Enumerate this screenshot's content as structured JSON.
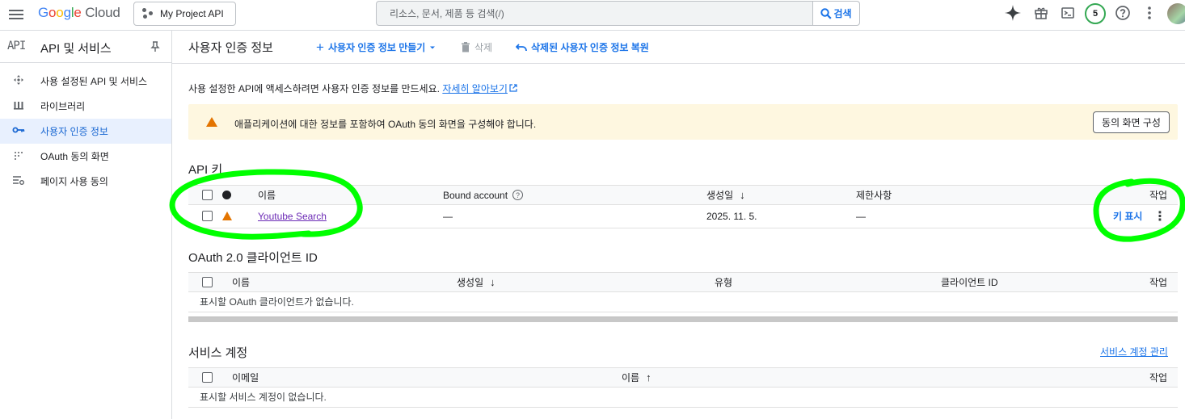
{
  "topbar": {
    "logo_parts": [
      "G",
      "o",
      "o",
      "g",
      "l",
      "e"
    ],
    "logo_cloud": "Cloud",
    "project_name": "My Project API",
    "search_placeholder": "리소스, 문서, 제품 등 검색(/)",
    "search_button": "검색",
    "notification_count": "5",
    "icons": [
      "menu-icon",
      "project-icon",
      "search-icon",
      "gemini-icon",
      "gift-icon",
      "terminal-icon",
      "help-icon",
      "more-vert-icon"
    ]
  },
  "sidebar": {
    "api_mark": "API",
    "title": "API 및 서비스",
    "items": [
      {
        "label": "사용 설정된 API 및 서비스",
        "icon": "enabled-apis-icon"
      },
      {
        "label": "라이브러리",
        "icon": "library-icon"
      },
      {
        "label": "사용자 인증 정보",
        "icon": "key-icon",
        "active": true
      },
      {
        "label": "OAuth 동의 화면",
        "icon": "oauth-icon"
      },
      {
        "label": "페이지 사용 동의",
        "icon": "page-consent-icon"
      }
    ]
  },
  "header": {
    "title": "사용자 인증 정보",
    "create_label": "사용자 인증 정보 만들기",
    "delete_label": "삭제",
    "restore_label": "삭제된 사용자 인증 정보 복원"
  },
  "intro": {
    "text": "사용 설정한 API에 액세스하려면 사용자 인증 정보를 만드세요.",
    "link": "자세히 알아보기"
  },
  "banner": {
    "text": "애플리케이션에 대한 정보를 포함하여 OAuth 동의 화면을 구성해야 합니다.",
    "button": "동의 화면 구성"
  },
  "api_keys": {
    "title": "API 키",
    "columns": [
      "이름",
      "Bound account",
      "생성일",
      "제한사항",
      "작업"
    ],
    "rows": [
      {
        "name": "Youtube Search",
        "bound_account": "—",
        "created": "2025. 11. 5.",
        "restrictions": "—",
        "action": "키 표시"
      }
    ]
  },
  "oauth_clients": {
    "title": "OAuth 2.0 클라이언트 ID",
    "columns": [
      "이름",
      "생성일",
      "유형",
      "클라이언트 ID",
      "작업"
    ],
    "empty": "표시할 OAuth 클라이언트가 없습니다."
  },
  "service_accounts": {
    "title": "서비스 계정",
    "manage_link": "서비스 계정 관리",
    "columns": [
      "이메일",
      "이름",
      "작업"
    ],
    "empty": "표시할 서비스 계정이 없습니다."
  },
  "colors": {
    "accent": "#1a73e8",
    "warning": "#e37400",
    "banner_bg": "#fef7e0",
    "annotation": "#00ff00"
  }
}
